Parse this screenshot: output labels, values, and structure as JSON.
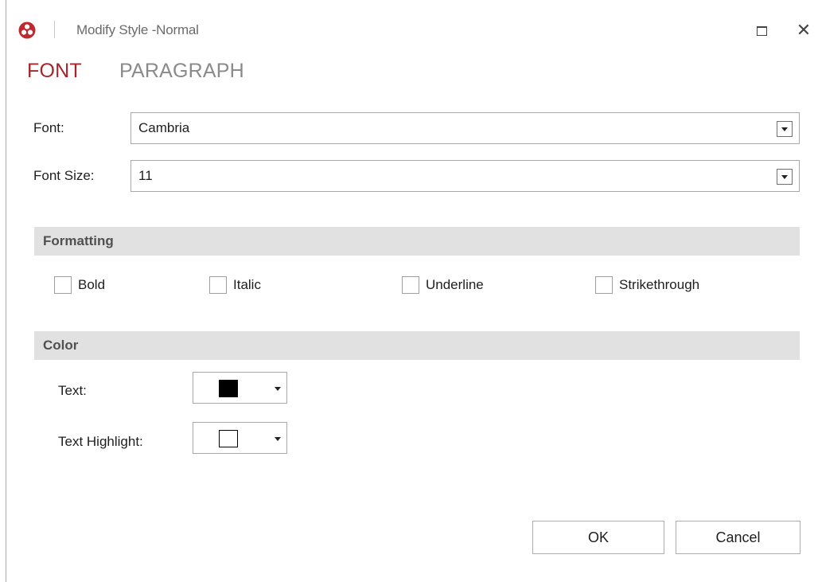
{
  "window": {
    "title": "Modify Style -Normal",
    "maximize_label": "□",
    "close_label": "✕"
  },
  "tabs": [
    {
      "label": "FONT",
      "active": true
    },
    {
      "label": "PARAGRAPH",
      "active": false
    }
  ],
  "font": {
    "label": "Font:",
    "value": "Cambria"
  },
  "font_size": {
    "label": "Font Size:",
    "value": "11"
  },
  "formatting": {
    "header": "Formatting",
    "options": [
      {
        "label": "Bold",
        "checked": false
      },
      {
        "label": "Italic",
        "checked": false
      },
      {
        "label": "Underline",
        "checked": false
      },
      {
        "label": "Strikethrough",
        "checked": false
      }
    ]
  },
  "color": {
    "header": "Color",
    "text_label": "Text:",
    "text_color": "#000000",
    "highlight_label": "Text Highlight:",
    "highlight_color": "#ffffff"
  },
  "buttons": {
    "ok": "OK",
    "cancel": "Cancel"
  },
  "colors": {
    "accent": "#a4262c",
    "inactive_tab": "#8a8a8a",
    "section_bg": "#e1e1e1",
    "title_text": "#6b6b6b"
  },
  "icons": {
    "app": "app-logo-icon",
    "maximize": "maximize-icon",
    "close": "close-icon",
    "dropdown": "chevron-down-icon"
  }
}
